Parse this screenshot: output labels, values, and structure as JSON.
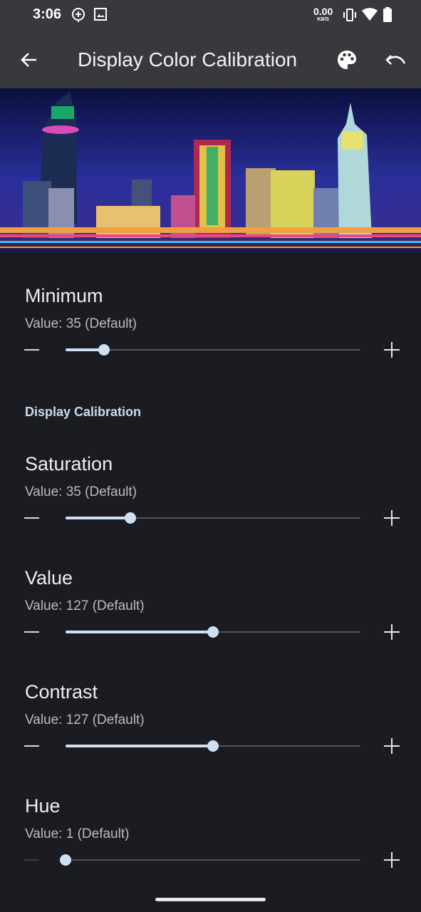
{
  "status_bar": {
    "time": "3:06",
    "net_speed": "0.00",
    "net_unit": "KB/S",
    "icons": [
      "location-plus-icon",
      "image-icon",
      "vibrate-icon",
      "wifi-icon",
      "battery-icon"
    ]
  },
  "app_bar": {
    "title": "Display Color Calibration",
    "back_icon": "arrow-back-icon",
    "actions": [
      "palette-icon",
      "undo-icon"
    ]
  },
  "banner": {
    "description_icon": "city-skyline-image"
  },
  "preferences": {
    "minimum": {
      "title": "Minimum",
      "summary": "Value: 35 (Default)",
      "level": 0.13
    },
    "category": "Display Calibration",
    "saturation": {
      "title": "Saturation",
      "summary": "Value: 35 (Default)",
      "level": 0.22
    },
    "value": {
      "title": "Value",
      "summary": "Value: 127 (Default)",
      "level": 0.5
    },
    "contrast": {
      "title": "Contrast",
      "summary": "Value: 127 (Default)",
      "level": 0.5
    },
    "hue": {
      "title": "Hue",
      "summary": "Value: 1 (Default)",
      "level": 0.0
    }
  },
  "colors": {
    "accent": "#cfe0f5",
    "background": "#1b1c21",
    "bar": "#37393d"
  }
}
